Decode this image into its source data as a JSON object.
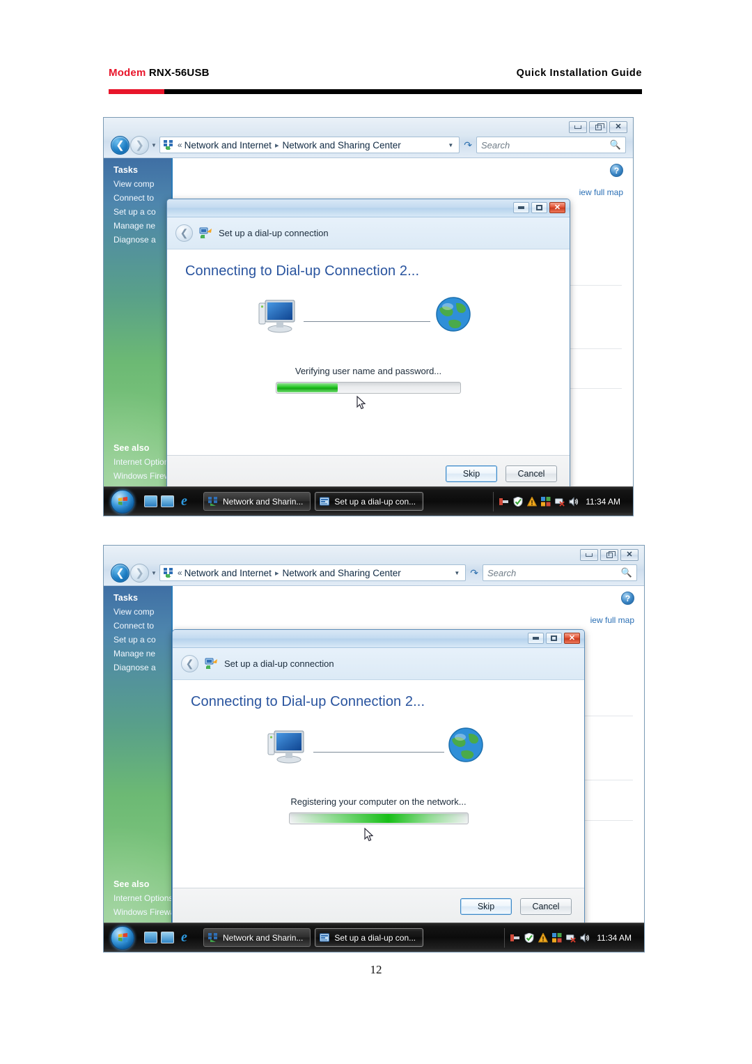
{
  "document": {
    "header_brand": "Modem",
    "header_model": "RNX-56USB",
    "header_right": "Quick Installation Guide",
    "page_number": "12",
    "accent_red": "#e8152a"
  },
  "explorer": {
    "breadcrumb_chevrons": "«",
    "breadcrumb": [
      "Network and Internet",
      "Network and Sharing Center"
    ],
    "breadcrumb_separator": "▸",
    "search_placeholder": "Search",
    "search_value": "",
    "refresh_icon": "refresh-icon",
    "window_buttons": [
      "minimize",
      "restore",
      "close"
    ],
    "help_icon_label": "?",
    "view_full_map": "iew full map",
    "sidebar": {
      "tasks_header": "Tasks",
      "tasks": [
        "View comp",
        "Connect to",
        "Set up a co",
        "Manage ne",
        "Diagnose a"
      ],
      "see_also_header": "See also",
      "see_also": [
        "Internet Options",
        "Windows Firewall"
      ]
    }
  },
  "dialog1": {
    "header_title": "Set up a dial-up connection",
    "heading": "Connecting to Dial-up Connection 2...",
    "status": "Verifying user name and password...",
    "progress_percent": 33,
    "progress_style": "solid",
    "buttons": {
      "skip": "Skip",
      "cancel": "Cancel"
    }
  },
  "dialog2": {
    "header_title": "Set up a dial-up connection",
    "heading": "Connecting to Dial-up Connection 2...",
    "status": "Registering your computer on the network...",
    "progress_percent": 100,
    "progress_style": "sweep",
    "buttons": {
      "skip": "Skip",
      "cancel": "Cancel"
    }
  },
  "taskbar": {
    "start_label": "start-orb",
    "quick_launch": [
      "show-desktop-icon",
      "switch-window-icon",
      "internet-explorer-icon"
    ],
    "buttons": [
      {
        "label": "Network and Sharin...",
        "state": "inactive"
      },
      {
        "label": "Set up a dial-up con...",
        "state": "active"
      }
    ],
    "tray_icons": [
      "safely-remove-icon",
      "security-shield-icon",
      "warning-icon",
      "action-center-icon",
      "network-disconnected-icon",
      "volume-icon"
    ],
    "clock": "11:34 AM"
  }
}
